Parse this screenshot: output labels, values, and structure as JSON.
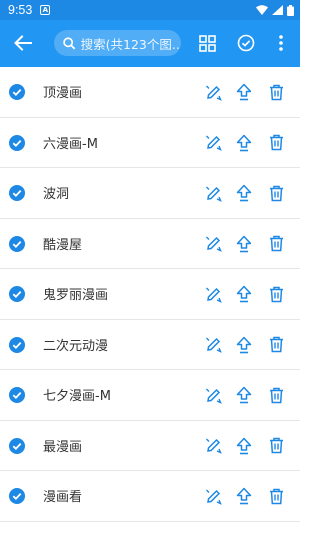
{
  "status": {
    "time": "9:53",
    "notif_icon": "A"
  },
  "toolbar": {
    "search_placeholder": "搜索(共123个图..."
  },
  "colors": {
    "primary": "#2196f3",
    "status": "#1e88e5",
    "accent": "#1e88e5"
  },
  "items": [
    {
      "label": "顶漫画",
      "checked": true
    },
    {
      "label": "六漫画-M",
      "checked": true
    },
    {
      "label": "波洞",
      "checked": true
    },
    {
      "label": "酷漫屋",
      "checked": true
    },
    {
      "label": "鬼罗丽漫画",
      "checked": true
    },
    {
      "label": "二次元动漫",
      "checked": true
    },
    {
      "label": "七夕漫画-M",
      "checked": true
    },
    {
      "label": "最漫画",
      "checked": true
    },
    {
      "label": "漫画看",
      "checked": true
    }
  ]
}
